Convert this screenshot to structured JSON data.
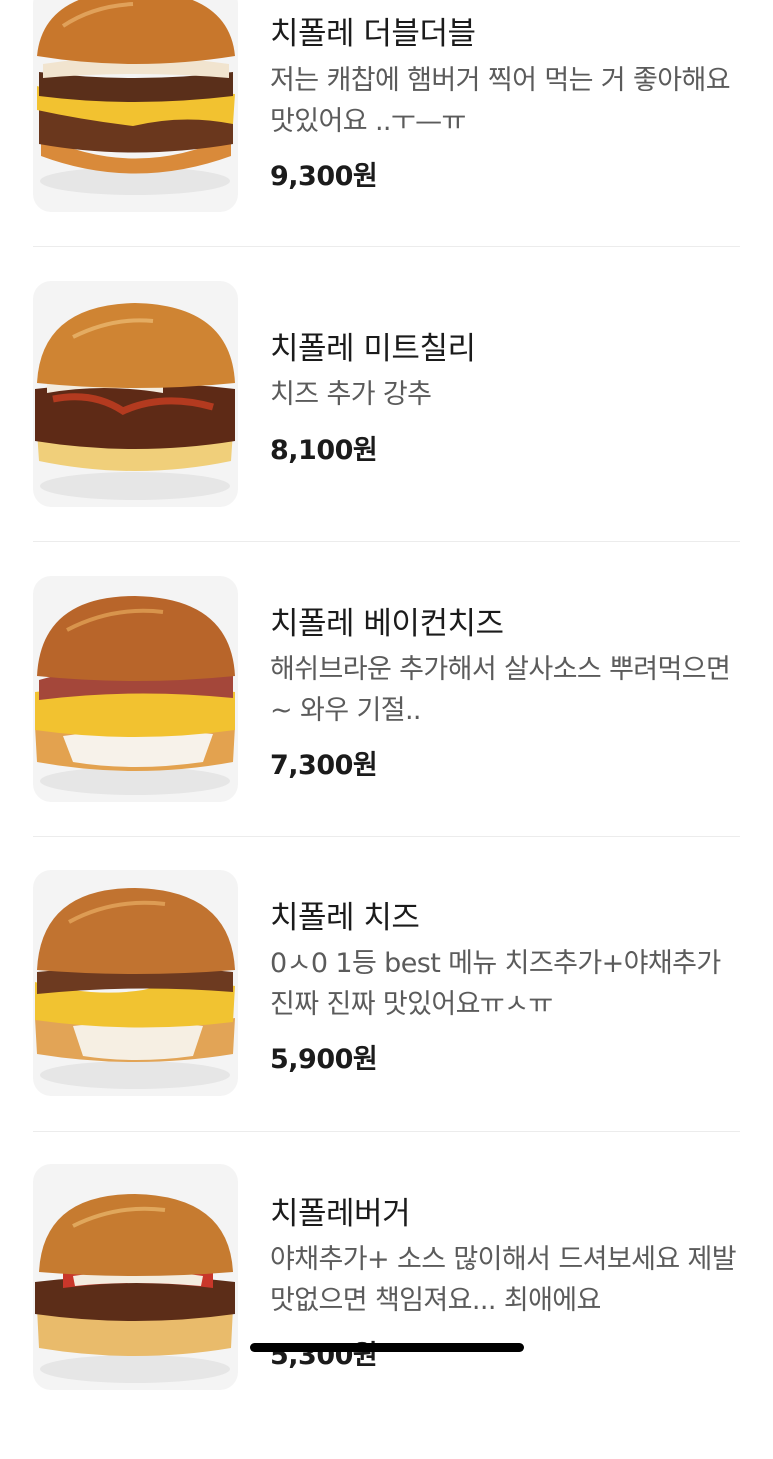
{
  "menu": {
    "items": [
      {
        "name": "치폴레 더블더블",
        "description": "저는 캐찹에 햄버거 찍어 먹는 거 좋아해요 맛있어요 ..ㅜ—ㅠ",
        "price": "9,300원",
        "image": "double-cheese-burger"
      },
      {
        "name": "치폴레 미트칠리",
        "description": "치즈 추가 강추",
        "price": "8,100원",
        "image": "meat-chili-burger"
      },
      {
        "name": "치폴레 베이컨치즈",
        "description": "해쉬브라운 추가해서 살사소스 뿌려먹으면~ 와우 기절..",
        "price": "7,300원",
        "image": "bacon-cheese-burger"
      },
      {
        "name": "치폴레 치즈",
        "description": "0ㅅ0 1등 best 메뉴 치즈추가+야채추가 진짜 진짜 맛있어요ㅠㅅㅠ",
        "price": "5,900원",
        "image": "cheese-burger"
      },
      {
        "name": "치폴레버거",
        "description": "야채추가+ 소스 많이해서 드셔보세요 제발 맛없으면 책임져요... 최애에요",
        "price": "5,300원",
        "image": "chipotle-burger"
      }
    ]
  },
  "colors": {
    "bun": "#c97a2e",
    "cheese": "#f3c233",
    "patty": "#5a2f1a",
    "onion": "#f4e9d8",
    "tomato": "#c9372a"
  }
}
